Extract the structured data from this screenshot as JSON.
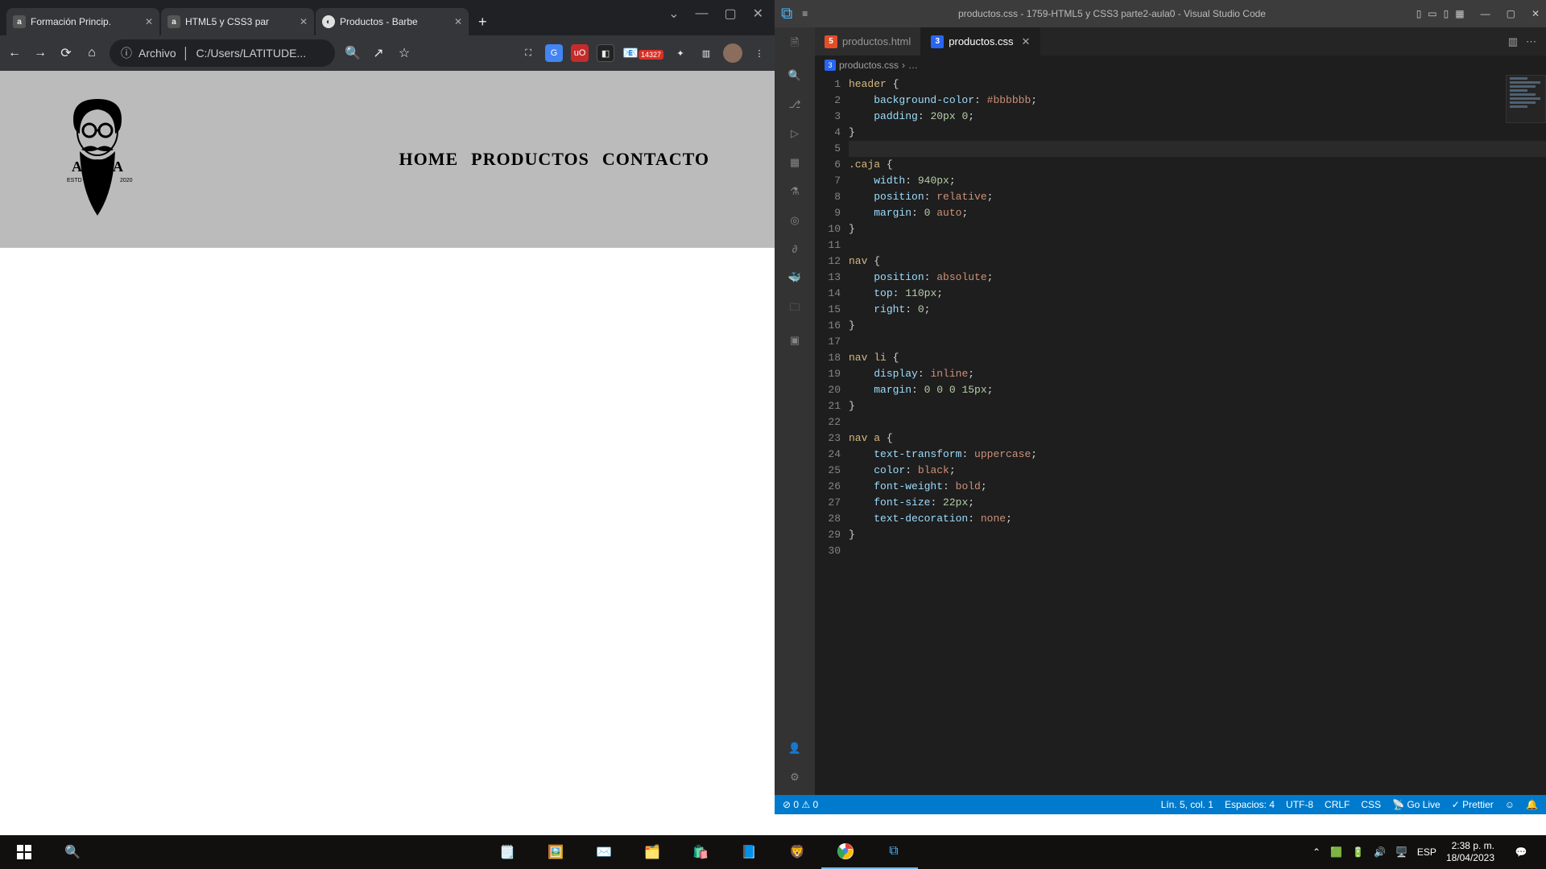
{
  "chrome": {
    "tabs": [
      {
        "label": "Formación Princip."
      },
      {
        "label": "HTML5 y CSS3 par"
      },
      {
        "label": "Productos - Barbe"
      }
    ],
    "url_label": "Archivo",
    "url_path": "C:/Users/LATITUDE...",
    "ext_badge": "14327",
    "nav": {
      "home": "HOME",
      "productos": "PRODUCTOS",
      "contacto": "CONTACTO"
    },
    "logo_text": "ALURA",
    "logo_sub_l": "ESTD",
    "logo_sub_r": "2020"
  },
  "vscode": {
    "title": "productos.css - 1759-HTML5 y CSS3 parte2-aula0 - Visual Studio Code",
    "tabs": [
      {
        "file": "productos.html"
      },
      {
        "file": "productos.css"
      }
    ],
    "breadcrumb": {
      "file": "productos.css",
      "rest": "…"
    },
    "code": {
      "lines": [
        {
          "n": "1",
          "sel": "header",
          "open": " {"
        },
        {
          "n": "2",
          "prop": "background-color",
          "sep": ": ",
          "val": "#bbbbbb",
          "end": ";"
        },
        {
          "n": "3",
          "prop": "padding",
          "sep": ": ",
          "num": "20px 0",
          "end": ";"
        },
        {
          "n": "4",
          "close": "}"
        },
        {
          "n": "5",
          "blank": true,
          "current": true
        },
        {
          "n": "6",
          "sel": ".caja",
          "open": " {"
        },
        {
          "n": "7",
          "prop": "width",
          "sep": ": ",
          "num": "940px",
          "end": ";"
        },
        {
          "n": "8",
          "prop": "position",
          "sep": ": ",
          "val": "relative",
          "end": ";"
        },
        {
          "n": "9",
          "prop": "margin",
          "sep": ": ",
          "num": "0 ",
          "val": "auto",
          "end": ";"
        },
        {
          "n": "10",
          "close": "}"
        },
        {
          "n": "11",
          "blank": true
        },
        {
          "n": "12",
          "sel": "nav",
          "open": " {"
        },
        {
          "n": "13",
          "prop": "position",
          "sep": ": ",
          "val": "absolute",
          "end": ";"
        },
        {
          "n": "14",
          "prop": "top",
          "sep": ": ",
          "num": "110px",
          "end": ";"
        },
        {
          "n": "15",
          "prop": "right",
          "sep": ": ",
          "num": "0",
          "end": ";"
        },
        {
          "n": "16",
          "close": "}"
        },
        {
          "n": "17",
          "blank": true
        },
        {
          "n": "18",
          "sel": "nav li",
          "open": " {"
        },
        {
          "n": "19",
          "prop": "display",
          "sep": ": ",
          "val": "inline",
          "end": ";"
        },
        {
          "n": "20",
          "prop": "margin",
          "sep": ": ",
          "num": "0 0 0 15px",
          "end": ";"
        },
        {
          "n": "21",
          "close": "}"
        },
        {
          "n": "22",
          "blank": true
        },
        {
          "n": "23",
          "sel": "nav a",
          "open": " {"
        },
        {
          "n": "24",
          "prop": "text-transform",
          "sep": ": ",
          "val": "uppercase",
          "end": ";"
        },
        {
          "n": "25",
          "prop": "color",
          "sep": ": ",
          "val": "black",
          "end": ";"
        },
        {
          "n": "26",
          "prop": "font-weight",
          "sep": ": ",
          "val": "bold",
          "end": ";"
        },
        {
          "n": "27",
          "prop": "font-size",
          "sep": ": ",
          "num": "22px",
          "end": ";"
        },
        {
          "n": "28",
          "prop": "text-decoration",
          "sep": ": ",
          "val": "none",
          "end": ";"
        },
        {
          "n": "29",
          "close": "}"
        },
        {
          "n": "30",
          "blank": true
        }
      ]
    },
    "status": {
      "errors": "⊘ 0 ⚠ 0",
      "pos": "Lín. 5, col. 1",
      "spaces": "Espacios: 4",
      "enc": "UTF-8",
      "eol": "CRLF",
      "lang": "CSS",
      "golive": "Go Live",
      "prettier": "✓ Prettier"
    }
  },
  "taskbar": {
    "time": "2:38 p. m.",
    "date": "18/04/2023",
    "lang": "ESP"
  }
}
